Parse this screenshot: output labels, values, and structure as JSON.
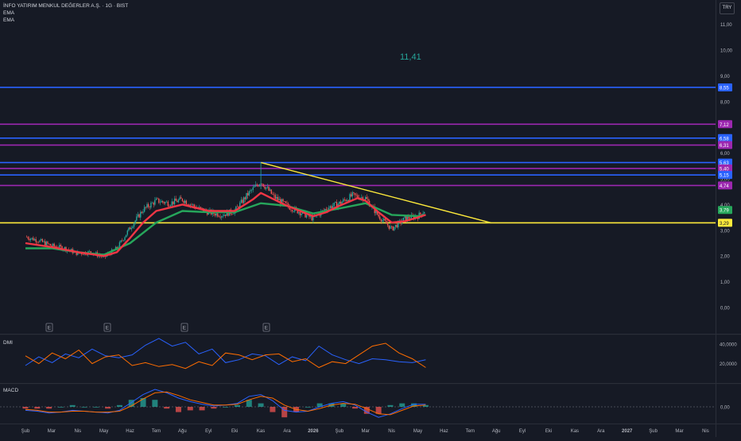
{
  "header": {
    "symbol_title": "İNFO YATIRIM MENKUL DEĞERLER A.Ş. · 1G · BIST",
    "indicators": [
      "EMA",
      "EMA"
    ]
  },
  "currency_button": "TRY",
  "center_label": "11,41",
  "colors": {
    "background": "#161a25",
    "ema_fast": "#f23645",
    "ema_slow": "#26a65b",
    "blue_line": "#2962ff",
    "purple_line": "#9c27b0",
    "yellow_line": "#ffeb3b",
    "dmi_plus": "#2962ff",
    "dmi_minus": "#ff6d00",
    "candle_up": "#26a69a",
    "candle_down": "#ef5350"
  },
  "chart_data": [
    {
      "type": "candlestick",
      "x_tick_labels": [
        "Şub",
        "Mar",
        "Nis",
        "May",
        "Haz",
        "Tem",
        "Ağu",
        "Eyl",
        "Eki",
        "Kas",
        "Ara",
        "2026",
        "Şub",
        "Mar",
        "Nis",
        "May",
        "Haz",
        "Tem",
        "Ağu",
        "Eyl",
        "Eki",
        "Kas",
        "Ara",
        "2027",
        "Şub",
        "Mar",
        "Nis"
      ],
      "y_tick_labels": [
        "0,00",
        "1,00",
        "2,00",
        "3,00",
        "4,00",
        "5,00",
        "6,00",
        "8,00",
        "9,00",
        "10,00",
        "11,00"
      ],
      "ylim": [
        -0.3,
        11.5
      ],
      "earnings_markers": [
        "E",
        "E",
        "E",
        "E"
      ],
      "close_path": [
        {
          "m": 0,
          "v": 2.75
        },
        {
          "m": 0.5,
          "v": 2.6
        },
        {
          "m": 1,
          "v": 2.4
        },
        {
          "m": 1.5,
          "v": 2.3
        },
        {
          "m": 2,
          "v": 2.1
        },
        {
          "m": 2.5,
          "v": 2.15
        },
        {
          "m": 3,
          "v": 1.95
        },
        {
          "m": 3.5,
          "v": 2.3
        },
        {
          "m": 4,
          "v": 3.1
        },
        {
          "m": 4.5,
          "v": 3.8
        },
        {
          "m": 5,
          "v": 4.15
        },
        {
          "m": 5.5,
          "v": 4.05
        },
        {
          "m": 6,
          "v": 4.2
        },
        {
          "m": 6.5,
          "v": 3.9
        },
        {
          "m": 7,
          "v": 3.7
        },
        {
          "m": 7.5,
          "v": 3.6
        },
        {
          "m": 8,
          "v": 3.75
        },
        {
          "m": 8.5,
          "v": 4.4
        },
        {
          "m": 9,
          "v": 4.9
        },
        {
          "m": 9.5,
          "v": 4.3
        },
        {
          "m": 10,
          "v": 3.95
        },
        {
          "m": 10.5,
          "v": 3.7
        },
        {
          "m": 11,
          "v": 3.45
        },
        {
          "m": 11.5,
          "v": 3.85
        },
        {
          "m": 12,
          "v": 4.05
        },
        {
          "m": 12.5,
          "v": 4.35
        },
        {
          "m": 13,
          "v": 4.25
        },
        {
          "m": 13.5,
          "v": 3.55
        },
        {
          "m": 14,
          "v": 3.05
        },
        {
          "m": 14.5,
          "v": 3.45
        },
        {
          "m": 15,
          "v": 3.55
        },
        {
          "m": 15.3,
          "v": 3.79
        }
      ],
      "ema_fast_path": [
        {
          "m": 0,
          "v": 2.5
        },
        {
          "m": 1,
          "v": 2.35
        },
        {
          "m": 2,
          "v": 2.15
        },
        {
          "m": 3,
          "v": 2.0
        },
        {
          "m": 3.5,
          "v": 2.15
        },
        {
          "m": 4,
          "v": 2.7
        },
        {
          "m": 4.5,
          "v": 3.3
        },
        {
          "m": 5,
          "v": 3.75
        },
        {
          "m": 6,
          "v": 4.0
        },
        {
          "m": 7,
          "v": 3.75
        },
        {
          "m": 8,
          "v": 3.75
        },
        {
          "m": 8.7,
          "v": 4.2
        },
        {
          "m": 9,
          "v": 4.45
        },
        {
          "m": 9.5,
          "v": 4.2
        },
        {
          "m": 10,
          "v": 3.95
        },
        {
          "m": 11,
          "v": 3.55
        },
        {
          "m": 11.5,
          "v": 3.7
        },
        {
          "m": 12,
          "v": 3.95
        },
        {
          "m": 12.7,
          "v": 4.25
        },
        {
          "m": 13,
          "v": 4.15
        },
        {
          "m": 13.5,
          "v": 3.7
        },
        {
          "m": 14,
          "v": 3.3
        },
        {
          "m": 14.5,
          "v": 3.35
        },
        {
          "m": 15,
          "v": 3.5
        },
        {
          "m": 15.3,
          "v": 3.6
        }
      ],
      "ema_slow_path": [
        {
          "m": 0,
          "v": 2.3
        },
        {
          "m": 1,
          "v": 2.3
        },
        {
          "m": 2,
          "v": 2.15
        },
        {
          "m": 3,
          "v": 2.05
        },
        {
          "m": 4,
          "v": 2.5
        },
        {
          "m": 5,
          "v": 3.3
        },
        {
          "m": 6,
          "v": 3.75
        },
        {
          "m": 7,
          "v": 3.7
        },
        {
          "m": 8,
          "v": 3.7
        },
        {
          "m": 9,
          "v": 4.05
        },
        {
          "m": 10,
          "v": 3.95
        },
        {
          "m": 11,
          "v": 3.65
        },
        {
          "m": 12,
          "v": 3.85
        },
        {
          "m": 13,
          "v": 4.05
        },
        {
          "m": 14,
          "v": 3.6
        },
        {
          "m": 15,
          "v": 3.55
        },
        {
          "m": 15.3,
          "v": 3.6
        }
      ],
      "horizontal_levels": [
        {
          "value": 8.55,
          "label": "8,55",
          "color": "blue"
        },
        {
          "value": 7.12,
          "label": "7,12",
          "color": "purple"
        },
        {
          "value": 6.58,
          "label": "6,58",
          "color": "blue"
        },
        {
          "value": 6.31,
          "label": "6,31",
          "color": "purple"
        },
        {
          "value": 5.63,
          "label": "5,63",
          "color": "blue"
        },
        {
          "value": 5.4,
          "label": "5,40",
          "color": "purple"
        },
        {
          "value": 5.15,
          "label": "5,15",
          "color": "blue"
        },
        {
          "value": 4.74,
          "label": "4,74",
          "color": "purple"
        },
        {
          "value": 3.29,
          "label": "3,29",
          "color": "yellow"
        }
      ],
      "price_tags": [
        {
          "value": 3.79,
          "label": "3,79",
          "color": "green"
        }
      ],
      "trendline": {
        "from": {
          "m": 9,
          "v": 5.63
        },
        "to": {
          "m": 17.8,
          "v": 3.29
        }
      }
    },
    {
      "type": "line",
      "title": "DMI",
      "y_tick_labels": [
        "40,0000",
        "20,0000"
      ],
      "series": [
        {
          "color": "blue",
          "values": [
            18,
            27,
            21,
            30,
            26,
            35,
            28,
            26,
            29,
            39,
            46,
            38,
            42,
            30,
            35,
            21,
            24,
            30,
            28,
            19,
            27,
            23,
            38,
            29,
            24,
            20,
            25,
            24,
            22,
            21,
            24
          ]
        },
        {
          "color": "orange",
          "values": [
            28,
            20,
            31,
            25,
            34,
            20,
            27,
            29,
            18,
            21,
            17,
            19,
            15,
            22,
            18,
            31,
            29,
            24,
            29,
            30,
            22,
            25,
            16,
            22,
            20,
            29,
            38,
            41,
            31,
            25,
            16
          ]
        }
      ]
    },
    {
      "type": "bar",
      "title": "MACD",
      "y_tick_labels": [
        "0,00"
      ],
      "series": [
        {
          "color": "blue",
          "values": [
            -0.04,
            -0.05,
            -0.07,
            -0.06,
            -0.04,
            -0.05,
            -0.06,
            -0.07,
            -0.04,
            0.05,
            0.14,
            0.2,
            0.16,
            0.1,
            0.06,
            0.03,
            0.01,
            0.02,
            0.04,
            0.12,
            0.14,
            0.07,
            -0.04,
            -0.06,
            -0.05,
            0.0,
            0.04,
            0.06,
            0.02,
            -0.06,
            -0.12,
            -0.08,
            -0.02,
            0.03,
            0.03
          ]
        },
        {
          "color": "orange",
          "values": [
            -0.03,
            -0.04,
            -0.06,
            -0.06,
            -0.05,
            -0.05,
            -0.06,
            -0.06,
            -0.05,
            0.01,
            0.09,
            0.16,
            0.17,
            0.13,
            0.08,
            0.05,
            0.02,
            0.02,
            0.03,
            0.08,
            0.12,
            0.1,
            0.02,
            -0.03,
            -0.05,
            -0.02,
            0.02,
            0.04,
            0.03,
            -0.02,
            -0.08,
            -0.09,
            -0.04,
            0.01,
            0.02
          ]
        }
      ]
    }
  ]
}
